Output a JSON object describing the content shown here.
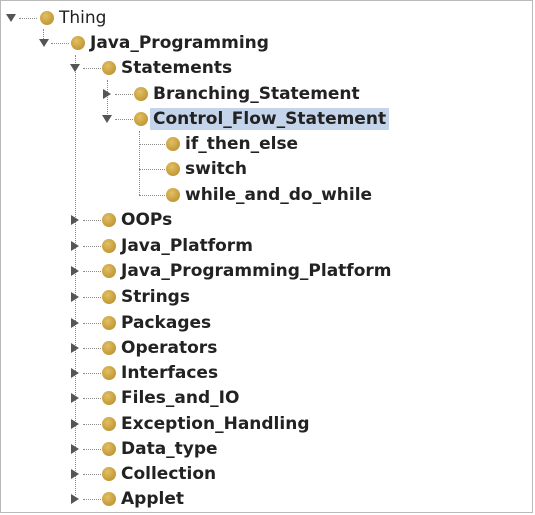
{
  "tree": {
    "root": {
      "label": "Thing",
      "expanded": true
    },
    "java_programming": {
      "label": "Java_Programming",
      "expanded": true
    },
    "statements": {
      "label": "Statements",
      "expanded": true
    },
    "branching_statement": {
      "label": "Branching_Statement",
      "expanded": false
    },
    "control_flow_statement": {
      "label": "Control_Flow_Statement",
      "expanded": true,
      "selected": true
    },
    "if_then_else": {
      "label": "if_then_else"
    },
    "switch": {
      "label": "switch"
    },
    "while_and_do_while": {
      "label": "while_and_do_while"
    },
    "oops": {
      "label": "OOPs",
      "expanded": false
    },
    "java_platform": {
      "label": "Java_Platform",
      "expanded": false
    },
    "java_programming_platform": {
      "label": "Java_Programming_Platform",
      "expanded": false
    },
    "strings": {
      "label": "Strings",
      "expanded": false
    },
    "packages": {
      "label": "Packages",
      "expanded": false
    },
    "operators": {
      "label": "Operators",
      "expanded": false
    },
    "interfaces": {
      "label": "Interfaces",
      "expanded": false
    },
    "files_and_io": {
      "label": "Files_and_IO",
      "expanded": false
    },
    "exception_handling": {
      "label": "Exception_Handling",
      "expanded": false
    },
    "data_type": {
      "label": "Data_type",
      "expanded": false
    },
    "collection": {
      "label": "Collection",
      "expanded": false
    },
    "applet": {
      "label": "Applet",
      "expanded": false
    }
  },
  "colors": {
    "node_dot": "#c9a13f",
    "selection": "#c4d4ea",
    "tree_line": "#8a8a8a"
  }
}
